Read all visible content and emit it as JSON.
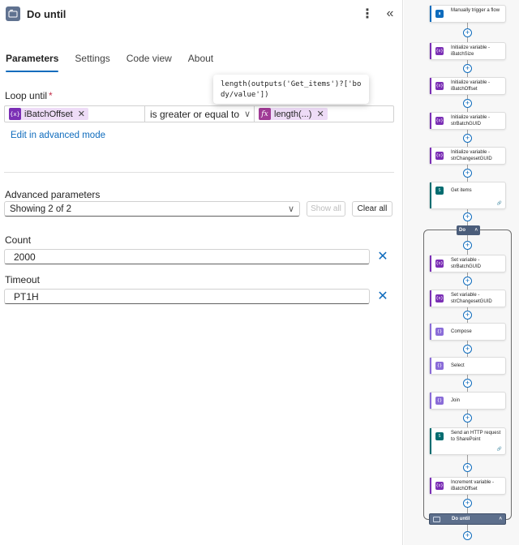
{
  "header": {
    "title": "Do until"
  },
  "tabs": [
    {
      "label": "Parameters"
    },
    {
      "label": "Settings"
    },
    {
      "label": "Code view"
    },
    {
      "label": "About"
    }
  ],
  "loop_until": {
    "label": "Loop until",
    "required_mark": "*",
    "left_token": {
      "icon": "{x}",
      "label": "iBatchOffset"
    },
    "operator": "is greater or equal to",
    "right_token": {
      "icon": "fx",
      "label": "length(...)"
    },
    "tooltip": "length(outputs('Get_items')?['body/value'])"
  },
  "advanced_mode_link": "Edit in advanced mode",
  "advanced": {
    "label": "Advanced parameters",
    "selected": "Showing 2 of 2",
    "show_all": "Show all",
    "clear_all": "Clear all"
  },
  "count": {
    "label": "Count",
    "value": "2000"
  },
  "timeout": {
    "label": "Timeout",
    "value": "PT1H"
  },
  "canvas": {
    "do_label": "Do",
    "until_label": "Do until",
    "nodes": [
      {
        "text": "Manually trigger a flow",
        "color": "#0f6cbd"
      },
      {
        "text": "Initialize variable - iBatchSize",
        "color": "#7b2fb5"
      },
      {
        "text": "Initialize variable - iBatchOffset",
        "color": "#7b2fb5"
      },
      {
        "text": "Initialize variable - strBatchGUID",
        "color": "#7b2fb5"
      },
      {
        "text": "Initialize variable - strChangesetGUID",
        "color": "#7b2fb5"
      },
      {
        "text": "Get items",
        "color": "#036c70"
      },
      {
        "text": "Set variable - strBatchGUID",
        "color": "#7b2fb5"
      },
      {
        "text": "Set variable - strChangesetGUID",
        "color": "#7b2fb5"
      },
      {
        "text": "Compose",
        "color": "#8a6cd8"
      },
      {
        "text": "Select",
        "color": "#8a6cd8"
      },
      {
        "text": "Join",
        "color": "#8a6cd8"
      },
      {
        "text": "Send an HTTP request to SharePoint",
        "color": "#036c70"
      },
      {
        "text": "Increment variable - iBatchOffset",
        "color": "#7b2fb5"
      }
    ]
  }
}
